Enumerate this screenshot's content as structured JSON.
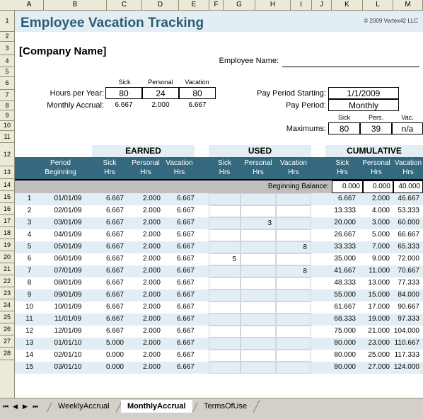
{
  "app": {
    "type": "spreadsheet",
    "column_headers": [
      "A",
      "B",
      "C",
      "D",
      "E",
      "F",
      "G",
      "H",
      "I",
      "J",
      "K",
      "L",
      "M"
    ],
    "row_headers": [
      "1",
      "2",
      "3",
      "4",
      "5",
      "6",
      "7",
      "8",
      "9",
      "10",
      "11",
      "12",
      "13",
      "14",
      "15",
      "16",
      "17",
      "18",
      "19",
      "20",
      "21",
      "22",
      "23",
      "24",
      "25",
      "26",
      "27",
      "28"
    ]
  },
  "header": {
    "title": "Employee Vacation Tracking",
    "copyright": "© 2009 Vertex42 LLC",
    "company_name": "[Company Name]"
  },
  "employee": {
    "name_label": "Employee Name:",
    "name_value": ""
  },
  "hours_per_year": {
    "label": "Hours per Year:",
    "columns": [
      "Sick",
      "Personal",
      "Vacation"
    ],
    "values": [
      "80",
      "24",
      "80"
    ]
  },
  "monthly_accrual": {
    "label": "Monthly Accrual:",
    "values": [
      "6.667",
      "2.000",
      "6.667"
    ]
  },
  "pay_period": {
    "starting_label": "Pay Period Starting:",
    "starting_value": "1/1/2009",
    "period_label": "Pay Period:",
    "period_value": "Monthly"
  },
  "maximums": {
    "label": "Maximums:",
    "columns": [
      "Sick",
      "Pers.",
      "Vac."
    ],
    "values": [
      "80",
      "39",
      "n/a"
    ]
  },
  "table": {
    "banners": [
      "EARNED",
      "USED",
      "CUMULATIVE"
    ],
    "col_period": {
      "line1": "Period",
      "line2": "Beginning"
    },
    "group_cols": [
      {
        "line1": "Sick",
        "line2": "Hrs"
      },
      {
        "line1": "Personal",
        "line2": "Hrs"
      },
      {
        "line1": "Vacation",
        "line2": "Hrs"
      }
    ],
    "beginning_balance": {
      "label": "Beginning Balance:",
      "sick": "0.000",
      "personal": "0.000",
      "vacation": "40.000"
    },
    "rows": [
      {
        "n": "1",
        "date": "01/01/09",
        "e_sick": "6.667",
        "e_pers": "2.000",
        "e_vac": "6.667",
        "u_sick": "",
        "u_pers": "",
        "u_vac": "",
        "c_sick": "6.667",
        "c_pers": "2.000",
        "c_vac": "46.667"
      },
      {
        "n": "2",
        "date": "02/01/09",
        "e_sick": "6.667",
        "e_pers": "2.000",
        "e_vac": "6.667",
        "u_sick": "",
        "u_pers": "",
        "u_vac": "",
        "c_sick": "13.333",
        "c_pers": "4.000",
        "c_vac": "53.333"
      },
      {
        "n": "3",
        "date": "03/01/09",
        "e_sick": "6.667",
        "e_pers": "2.000",
        "e_vac": "6.667",
        "u_sick": "",
        "u_pers": "3",
        "u_vac": "",
        "c_sick": "20.000",
        "c_pers": "3.000",
        "c_vac": "60.000"
      },
      {
        "n": "4",
        "date": "04/01/09",
        "e_sick": "6.667",
        "e_pers": "2.000",
        "e_vac": "6.667",
        "u_sick": "",
        "u_pers": "",
        "u_vac": "",
        "c_sick": "26.667",
        "c_pers": "5.000",
        "c_vac": "66.667"
      },
      {
        "n": "5",
        "date": "05/01/09",
        "e_sick": "6.667",
        "e_pers": "2.000",
        "e_vac": "6.667",
        "u_sick": "",
        "u_pers": "",
        "u_vac": "8",
        "c_sick": "33.333",
        "c_pers": "7.000",
        "c_vac": "65.333"
      },
      {
        "n": "6",
        "date": "06/01/09",
        "e_sick": "6.667",
        "e_pers": "2.000",
        "e_vac": "6.667",
        "u_sick": "5",
        "u_pers": "",
        "u_vac": "",
        "c_sick": "35.000",
        "c_pers": "9.000",
        "c_vac": "72.000"
      },
      {
        "n": "7",
        "date": "07/01/09",
        "e_sick": "6.667",
        "e_pers": "2.000",
        "e_vac": "6.667",
        "u_sick": "",
        "u_pers": "",
        "u_vac": "8",
        "c_sick": "41.667",
        "c_pers": "11.000",
        "c_vac": "70.667"
      },
      {
        "n": "8",
        "date": "08/01/09",
        "e_sick": "6.667",
        "e_pers": "2.000",
        "e_vac": "6.667",
        "u_sick": "",
        "u_pers": "",
        "u_vac": "",
        "c_sick": "48.333",
        "c_pers": "13.000",
        "c_vac": "77.333"
      },
      {
        "n": "9",
        "date": "09/01/09",
        "e_sick": "6.667",
        "e_pers": "2.000",
        "e_vac": "6.667",
        "u_sick": "",
        "u_pers": "",
        "u_vac": "",
        "c_sick": "55.000",
        "c_pers": "15.000",
        "c_vac": "84.000"
      },
      {
        "n": "10",
        "date": "10/01/09",
        "e_sick": "6.667",
        "e_pers": "2.000",
        "e_vac": "6.667",
        "u_sick": "",
        "u_pers": "",
        "u_vac": "",
        "c_sick": "61.667",
        "c_pers": "17.000",
        "c_vac": "90.667"
      },
      {
        "n": "11",
        "date": "11/01/09",
        "e_sick": "6.667",
        "e_pers": "2.000",
        "e_vac": "6.667",
        "u_sick": "",
        "u_pers": "",
        "u_vac": "",
        "c_sick": "68.333",
        "c_pers": "19.000",
        "c_vac": "97.333"
      },
      {
        "n": "12",
        "date": "12/01/09",
        "e_sick": "6.667",
        "e_pers": "2.000",
        "e_vac": "6.667",
        "u_sick": "",
        "u_pers": "",
        "u_vac": "",
        "c_sick": "75.000",
        "c_pers": "21.000",
        "c_vac": "104.000"
      },
      {
        "n": "13",
        "date": "01/01/10",
        "e_sick": "5.000",
        "e_pers": "2.000",
        "e_vac": "6.667",
        "u_sick": "",
        "u_pers": "",
        "u_vac": "",
        "c_sick": "80.000",
        "c_pers": "23.000",
        "c_vac": "110.667"
      },
      {
        "n": "14",
        "date": "02/01/10",
        "e_sick": "0.000",
        "e_pers": "2.000",
        "e_vac": "6.667",
        "u_sick": "",
        "u_pers": "",
        "u_vac": "",
        "c_sick": "80.000",
        "c_pers": "25.000",
        "c_vac": "117.333"
      },
      {
        "n": "15",
        "date": "03/01/10",
        "e_sick": "0.000",
        "e_pers": "2.000",
        "e_vac": "6.667",
        "u_sick": "",
        "u_pers": "",
        "u_vac": "",
        "c_sick": "80.000",
        "c_pers": "27.000",
        "c_vac": "124.000"
      }
    ]
  },
  "tabs": [
    {
      "label": "WeeklyAccrual",
      "active": false
    },
    {
      "label": "MonthlyAccrual",
      "active": true
    },
    {
      "label": "TermsOfUse",
      "active": false
    }
  ],
  "nav_buttons": [
    "⏮",
    "◀",
    "▶",
    "⏭"
  ],
  "colors": {
    "header_teal": "#35697f",
    "band_blue": "#e3eef4",
    "title_text": "#2a5d73",
    "gray_row": "#bfbfbf",
    "chrome": "#ece9d8"
  }
}
